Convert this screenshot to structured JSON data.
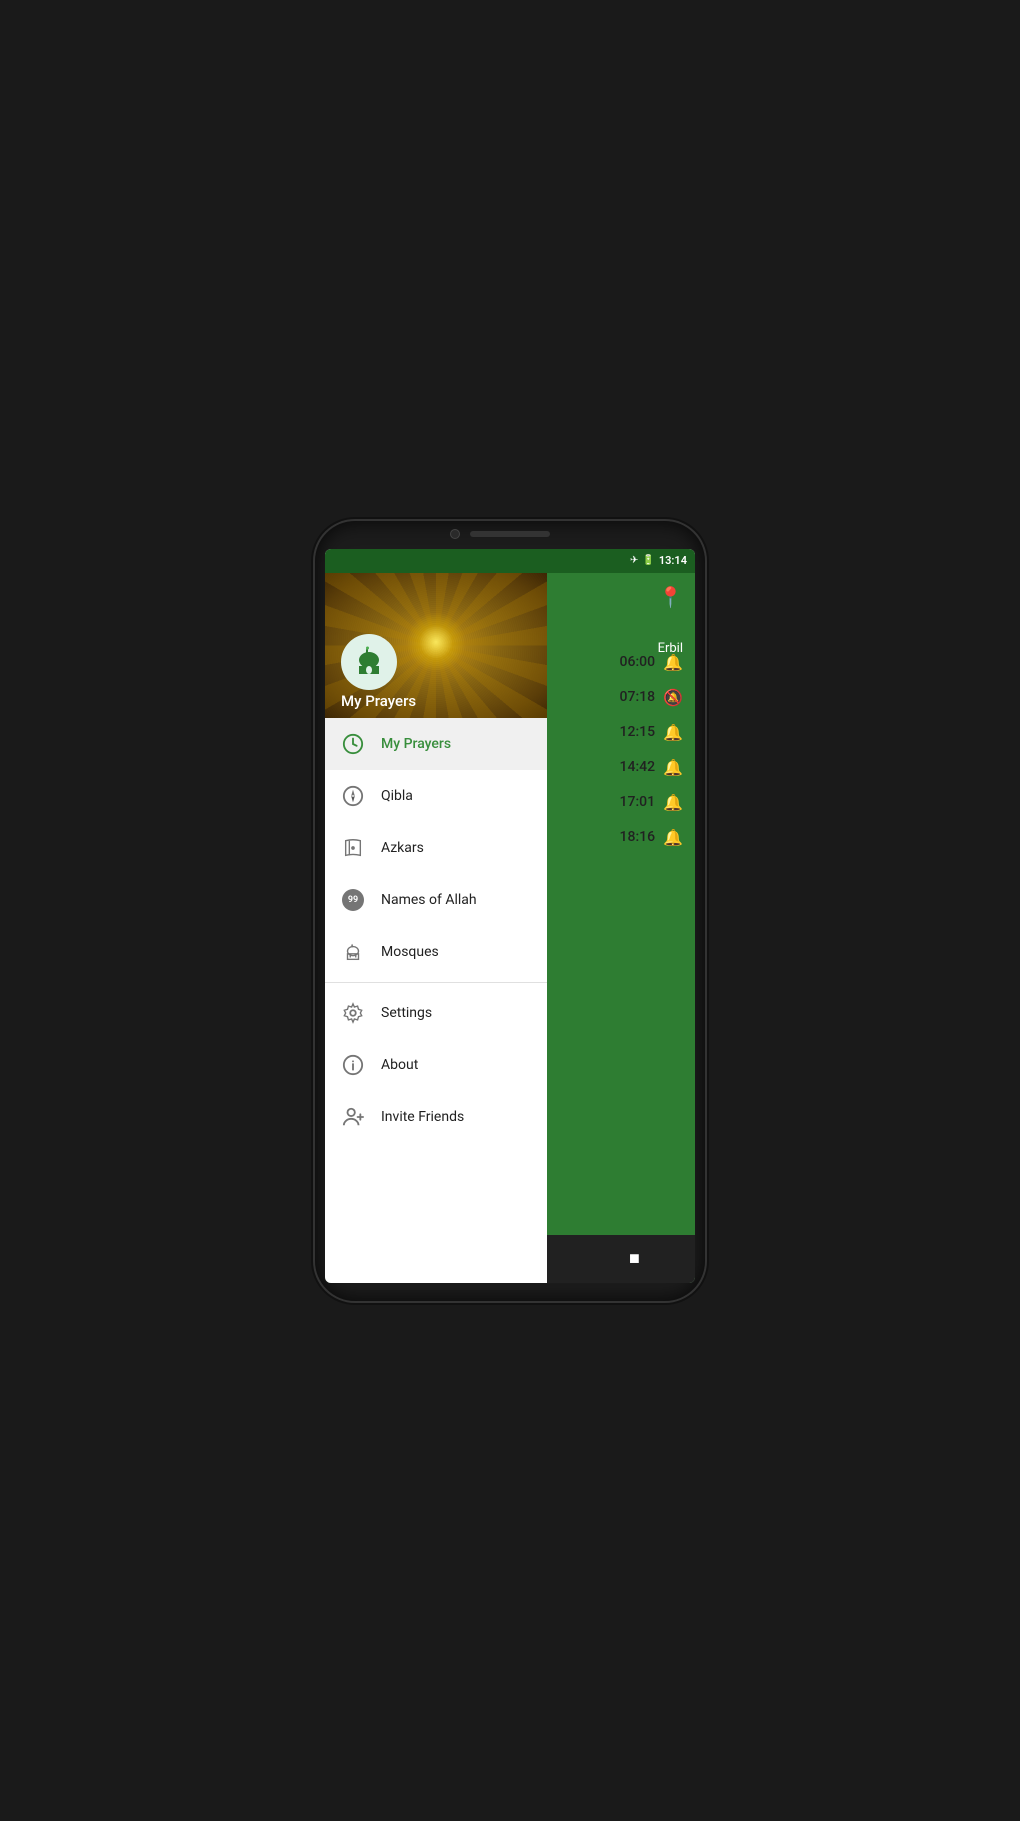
{
  "statusBar": {
    "time": "13:14",
    "icons": [
      "airplane",
      "battery",
      "clock"
    ]
  },
  "mainContent": {
    "city": "Erbil",
    "prayerTimes": [
      {
        "time": "06:00",
        "bellActive": true
      },
      {
        "time": "07:18",
        "bellActive": false
      },
      {
        "time": "12:15",
        "bellActive": true
      },
      {
        "time": "14:42",
        "bellActive": true
      },
      {
        "time": "17:01",
        "bellActive": true
      },
      {
        "time": "18:16",
        "bellActive": true
      }
    ]
  },
  "drawer": {
    "appName": "My Prayers",
    "menuItems": [
      {
        "id": "my-prayers",
        "label": "My Prayers",
        "icon": "clock",
        "active": true
      },
      {
        "id": "qibla",
        "label": "Qibla",
        "icon": "compass",
        "active": false
      },
      {
        "id": "azkars",
        "label": "Azkars",
        "icon": "book",
        "active": false
      },
      {
        "id": "names-of-allah",
        "label": "Names of Allah",
        "icon": "badge-99",
        "active": false
      },
      {
        "id": "mosques",
        "label": "Mosques",
        "icon": "mosque",
        "active": false
      }
    ],
    "secondaryItems": [
      {
        "id": "settings",
        "label": "Settings",
        "icon": "gear",
        "active": false
      },
      {
        "id": "about",
        "label": "About",
        "icon": "info",
        "active": false
      },
      {
        "id": "invite-friends",
        "label": "Invite Friends",
        "icon": "person-add",
        "active": false
      }
    ]
  },
  "bottomNav": {
    "back": "◄",
    "home": "●",
    "recent": "■"
  }
}
